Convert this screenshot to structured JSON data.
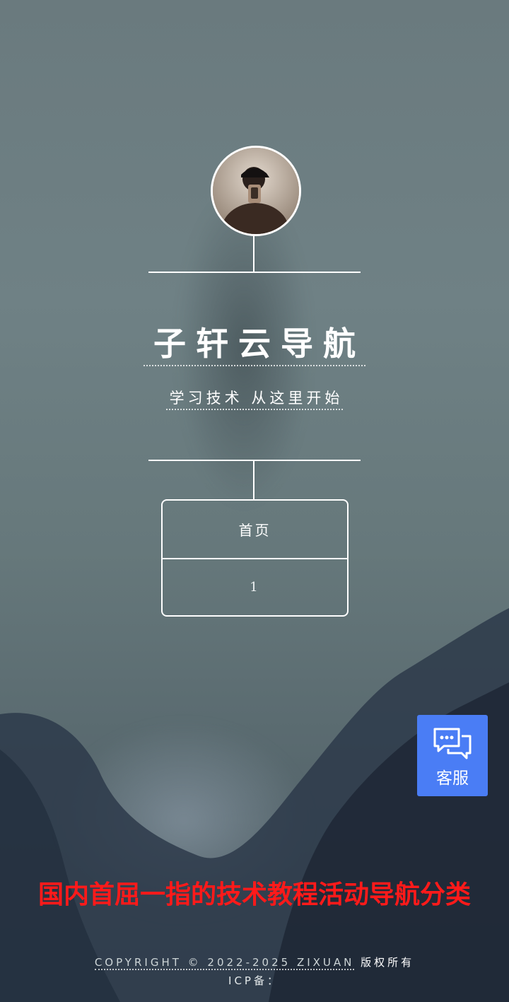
{
  "site": {
    "title": "子轩云导航",
    "subtitle": "学习技术 从这里开始"
  },
  "nav": {
    "items": [
      {
        "label": "首页"
      },
      {
        "label": "1"
      }
    ]
  },
  "service": {
    "label": "客服",
    "icon": "chat-bubbles-icon",
    "color": "#4a7df5"
  },
  "promo": {
    "text": "国内首屈一指的技术教程活动导航分类",
    "color": "#ff1a1a"
  },
  "footer": {
    "copyright": "COPYRIGHT © 2022-2025 ZIXUAN",
    "rights": "版权所有",
    "icp": "ICP备："
  }
}
